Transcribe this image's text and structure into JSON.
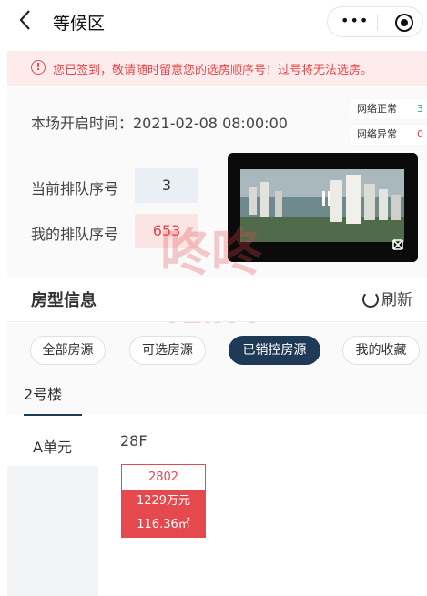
{
  "header": {
    "title": "等候区",
    "more_dots": "•••"
  },
  "notice": {
    "text": "您已签到，敬请随时留意您的选房顺序号！过号将无法选房。"
  },
  "session": {
    "open_time": "本场开启时间：2021-02-08 08:00:00"
  },
  "network": {
    "ok_label": "网络正常",
    "ok_count": "3",
    "bad_label": "网络异常",
    "bad_count": "0"
  },
  "queue": {
    "current_label": "当前排队序号",
    "current_value": "3",
    "mine_label": "我的排队序号",
    "mine_value": "653"
  },
  "watermark": {
    "line1": "咚咚",
    "line2": "找房"
  },
  "house_info": {
    "title": "房型信息",
    "refresh_label": "刷新"
  },
  "filters": [
    {
      "label": "全部房源"
    },
    {
      "label": "可选房源"
    },
    {
      "label": "已销控房源"
    },
    {
      "label": "我的收藏"
    }
  ],
  "building": {
    "tab": "2号楼"
  },
  "units": {
    "unit_label": "A单元",
    "floor": "28F"
  },
  "room": {
    "number": "2802",
    "price": "1229万元",
    "area": "116.36㎡"
  },
  "colors": {
    "accent": "#1f3a56",
    "alert": "#e5484d",
    "notice_bg": "#fdeceb"
  }
}
